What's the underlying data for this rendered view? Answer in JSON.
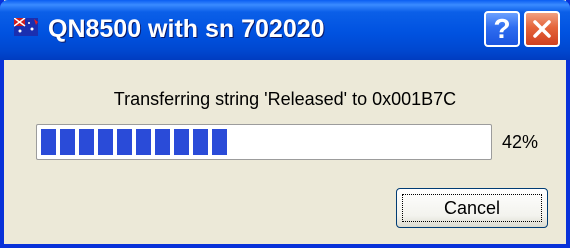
{
  "window": {
    "title": "QN8500 with sn 702020",
    "app_icon": "flag-app-icon",
    "help_label": "?",
    "help_icon": "help-icon",
    "close_icon": "close-icon",
    "title_bar_color": "#0054e3",
    "close_color": "#e04e24"
  },
  "dialog": {
    "message": "Transferring string 'Released' to 0x001B7C",
    "progress_fraction": 0.42,
    "progress_label": "42%",
    "progress_color": "#2a4bd8",
    "cancel_label": "Cancel"
  }
}
